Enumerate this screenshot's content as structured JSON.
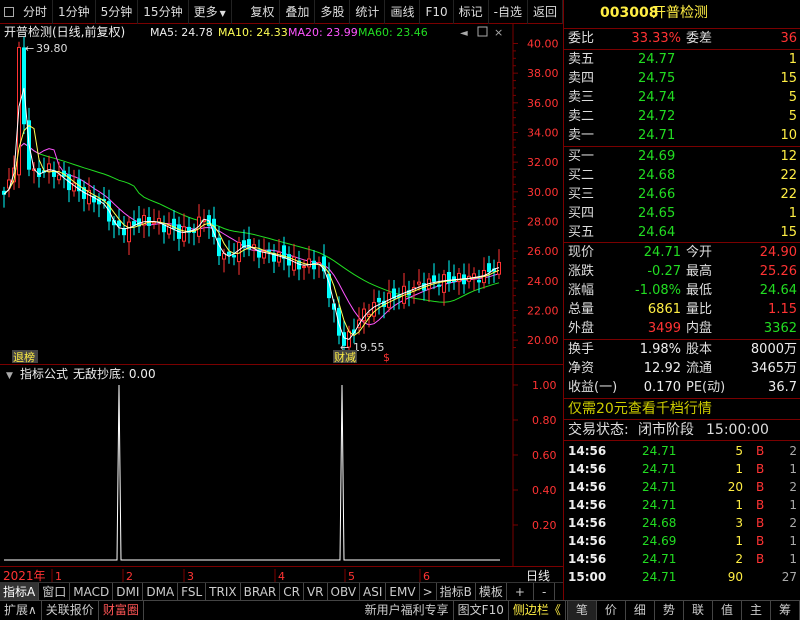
{
  "toolbar": {
    "items": [
      "分时",
      "1分钟",
      "5分钟",
      "15分钟",
      "更多",
      "复权",
      "叠加",
      "多股",
      "统计",
      "画线",
      "F10",
      "标记",
      "-自选",
      "返回"
    ]
  },
  "chart": {
    "title": "开普检测(日线,前复权)",
    "ma5": "MA5: 24.78",
    "ma10": "MA10: 24.33",
    "ma20": "MA20: 23.99",
    "ma60": "MA60: 23.46",
    "high_label": "39.80",
    "low_label": "19.55",
    "tag_left": "退榜",
    "tag_mid": "财减",
    "tag_dollar": "$",
    "y_ticks": [
      "40.00",
      "38.00",
      "36.00",
      "34.00",
      "32.00",
      "30.00",
      "28.00",
      "26.00",
      "24.00",
      "22.00",
      "20.00"
    ],
    "colors": {
      "up": "#ff3333",
      "down": "#00ffff",
      "ma5": "#ffffff",
      "ma10": "#ffff55",
      "ma20": "#ff55ff",
      "ma60": "#22dd22"
    }
  },
  "indicator": {
    "title": "指标公式",
    "name": "无敌抄底: 0.00",
    "y_ticks": [
      "1.00",
      "0.80",
      "0.60",
      "0.40",
      "0.20"
    ]
  },
  "timeaxis": {
    "year": "2021年",
    "months": [
      "1",
      "2",
      "3",
      "4",
      "5",
      "6"
    ],
    "period": "日线"
  },
  "tabs": [
    "指标A",
    "窗口",
    "MACD",
    "DMI",
    "DMA",
    "FSL",
    "TRIX",
    "BRAR",
    "CR",
    "VR",
    "OBV",
    "ASI",
    "EMV",
    ">",
    "指标B",
    "模板",
    "+",
    "-"
  ],
  "bottombar": {
    "left": [
      "扩展∧",
      "关联报价",
      "财富圈"
    ],
    "right": [
      "新用户福利专享",
      "图文F10",
      "侧边栏《"
    ],
    "panel_tabs": [
      "笔",
      "价",
      "细",
      "势",
      "联",
      "值",
      "主",
      "筹"
    ]
  },
  "quote": {
    "code": "003008",
    "name": "开普检测",
    "weibi_label": "委比",
    "weibi": "33.33%",
    "weicha_label": "委差",
    "weicha": "36",
    "asks": [
      {
        "label": "卖五",
        "price": "24.77",
        "vol": "1"
      },
      {
        "label": "卖四",
        "price": "24.75",
        "vol": "15"
      },
      {
        "label": "卖三",
        "price": "24.74",
        "vol": "5"
      },
      {
        "label": "卖二",
        "price": "24.72",
        "vol": "5"
      },
      {
        "label": "卖一",
        "price": "24.71",
        "vol": "10"
      }
    ],
    "bids": [
      {
        "label": "买一",
        "price": "24.69",
        "vol": "12"
      },
      {
        "label": "买二",
        "price": "24.68",
        "vol": "22"
      },
      {
        "label": "买三",
        "price": "24.66",
        "vol": "22"
      },
      {
        "label": "买四",
        "price": "24.65",
        "vol": "1"
      },
      {
        "label": "买五",
        "price": "24.64",
        "vol": "15"
      }
    ],
    "stats": [
      {
        "l1": "现价",
        "v1": "24.71",
        "c1": "green",
        "l2": "今开",
        "v2": "24.90",
        "c2": "red"
      },
      {
        "l1": "涨跌",
        "v1": "-0.27",
        "c1": "green",
        "l2": "最高",
        "v2": "25.26",
        "c2": "red"
      },
      {
        "l1": "涨幅",
        "v1": "-1.08%",
        "c1": "green",
        "l2": "最低",
        "v2": "24.64",
        "c2": "green"
      },
      {
        "l1": "总量",
        "v1": "6861",
        "c1": "yellow",
        "l2": "量比",
        "v2": "1.15",
        "c2": "red"
      },
      {
        "l1": "外盘",
        "v1": "3499",
        "c1": "red",
        "l2": "内盘",
        "v2": "3362",
        "c2": "green"
      }
    ],
    "stats2": [
      {
        "l1": "换手",
        "v1": "1.98%",
        "l2": "股本",
        "v2": "8000万"
      },
      {
        "l1": "净资",
        "v1": "12.92",
        "l2": "流通",
        "v2": "3465万"
      },
      {
        "l1": "收益(一)",
        "v1": "0.170",
        "l2": "PE(动)",
        "v2": "36.7"
      }
    ],
    "promo": "仅需20元查看千档行情",
    "status_label": "交易状态:",
    "status_value": "闭市阶段",
    "status_time": "15:00:00",
    "ticks": [
      {
        "time": "14:56",
        "price": "24.71",
        "vol": "5",
        "bs": "B",
        "n": "2"
      },
      {
        "time": "14:56",
        "price": "24.71",
        "vol": "1",
        "bs": "B",
        "n": "1"
      },
      {
        "time": "14:56",
        "price": "24.71",
        "vol": "20",
        "bs": "B",
        "n": "2"
      },
      {
        "time": "14:56",
        "price": "24.71",
        "vol": "1",
        "bs": "B",
        "n": "1"
      },
      {
        "time": "14:56",
        "price": "24.68",
        "vol": "3",
        "bs": "B",
        "n": "2"
      },
      {
        "time": "14:56",
        "price": "24.69",
        "vol": "1",
        "bs": "B",
        "n": "1"
      },
      {
        "time": "14:56",
        "price": "24.71",
        "vol": "2",
        "bs": "B",
        "n": "1"
      },
      {
        "time": "15:00",
        "price": "24.71",
        "vol": "90",
        "bs": "",
        "n": "27"
      }
    ]
  }
}
